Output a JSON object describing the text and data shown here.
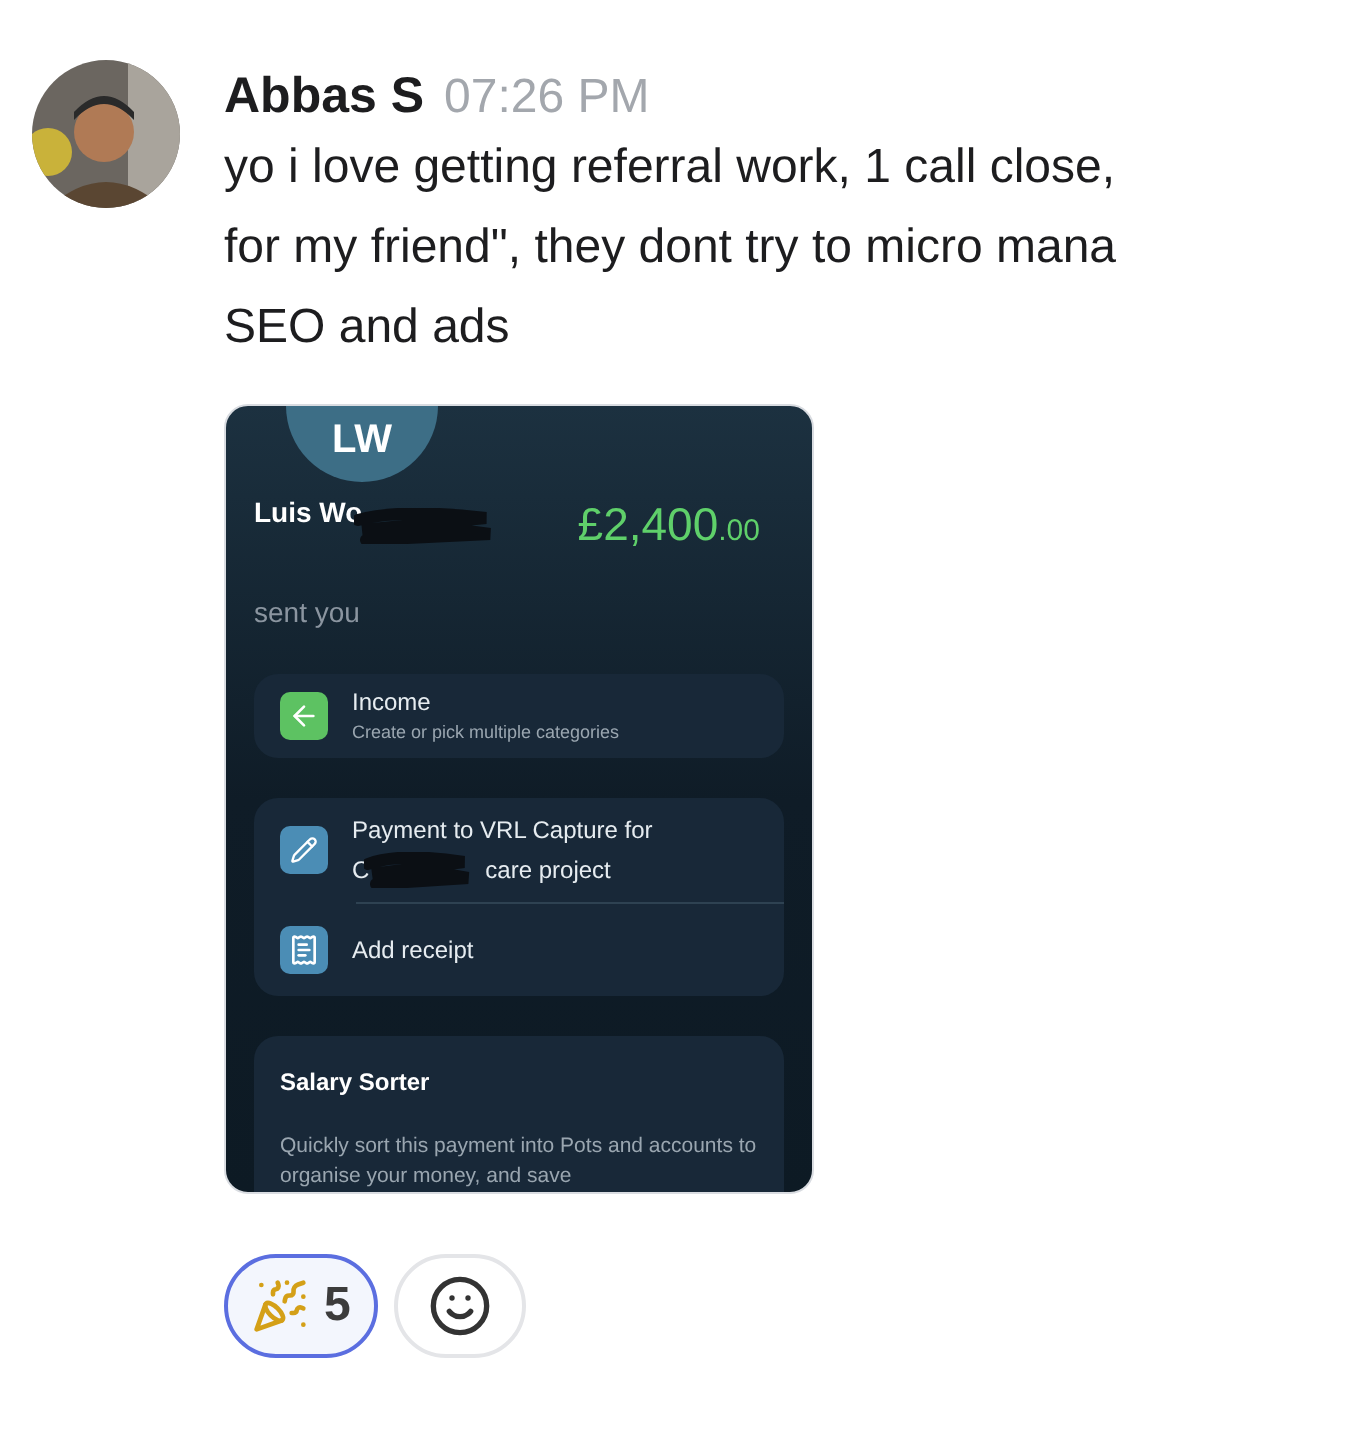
{
  "message": {
    "author": "Abbas S",
    "time": "07:26 PM",
    "lines": [
      "yo i love getting referral work, 1 call close,",
      "for my friend\", they dont try to micro mana",
      "SEO and ads"
    ]
  },
  "attachment": {
    "initials": "LW",
    "sender_name": "Luis Wo",
    "amount_main": "£2,400",
    "amount_cents": ".00",
    "sender_caption": "sent you",
    "category": {
      "title": "Income",
      "subtitle": "Create or pick multiple categories"
    },
    "note": {
      "line_1": "Payment to VRL Capture for",
      "line_2_start": "C",
      "line_2_end": "care project"
    },
    "receipt": {
      "label": "Add receipt"
    },
    "sorter": {
      "title": "Salary Sorter",
      "body": "Quickly sort this payment into Pots and accounts to organise your money, and save"
    }
  },
  "reactions": [
    {
      "kind": "party",
      "count": "5",
      "selected": true
    },
    {
      "kind": "add",
      "selected": false
    }
  ]
}
